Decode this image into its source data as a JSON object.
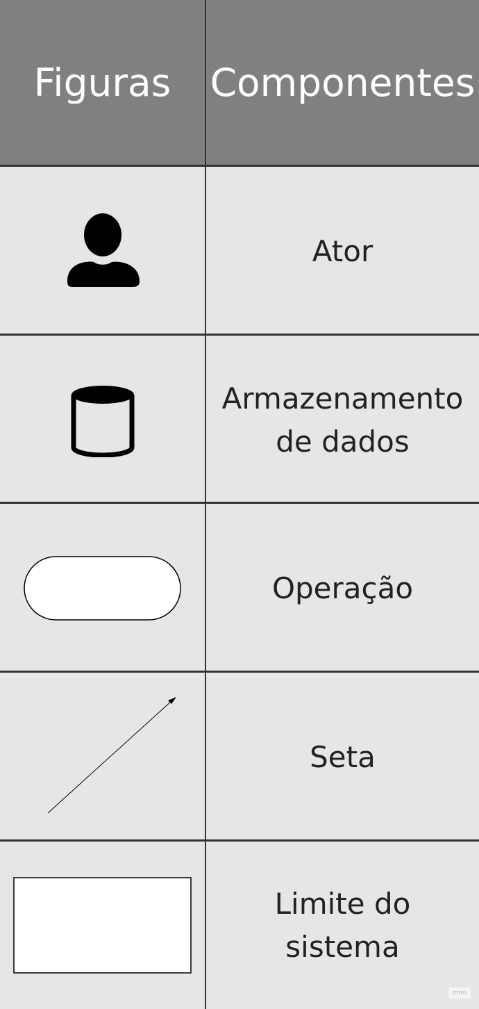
{
  "table": {
    "headers": [
      "Figuras",
      "Componentes"
    ],
    "rows": [
      {
        "figure": "actor-icon",
        "label": "Ator"
      },
      {
        "figure": "database-icon",
        "label": "Armazenamento\nde dados"
      },
      {
        "figure": "rounded-rectangle-shape",
        "label": "Operação"
      },
      {
        "figure": "arrow-shape",
        "label": "Seta"
      },
      {
        "figure": "rectangle-shape",
        "label": "Limite do\nsistema"
      }
    ]
  },
  "colors": {
    "header_bg": "#808080",
    "body_bg": "#e6e6e6",
    "grid": "#333333"
  },
  "watermark": "miro"
}
